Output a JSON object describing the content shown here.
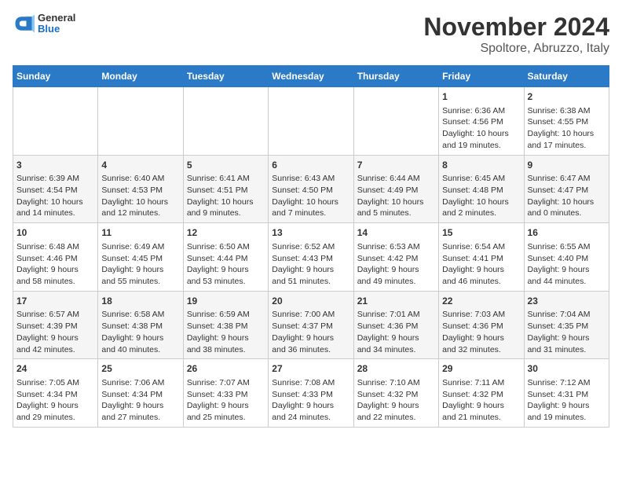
{
  "logo": {
    "general": "General",
    "blue": "Blue"
  },
  "header": {
    "title": "November 2024",
    "subtitle": "Spoltore, Abruzzo, Italy"
  },
  "weekdays": [
    "Sunday",
    "Monday",
    "Tuesday",
    "Wednesday",
    "Thursday",
    "Friday",
    "Saturday"
  ],
  "weeks": [
    [
      {
        "day": "",
        "info": ""
      },
      {
        "day": "",
        "info": ""
      },
      {
        "day": "",
        "info": ""
      },
      {
        "day": "",
        "info": ""
      },
      {
        "day": "",
        "info": ""
      },
      {
        "day": "1",
        "info": "Sunrise: 6:36 AM\nSunset: 4:56 PM\nDaylight: 10 hours\nand 19 minutes."
      },
      {
        "day": "2",
        "info": "Sunrise: 6:38 AM\nSunset: 4:55 PM\nDaylight: 10 hours\nand 17 minutes."
      }
    ],
    [
      {
        "day": "3",
        "info": "Sunrise: 6:39 AM\nSunset: 4:54 PM\nDaylight: 10 hours\nand 14 minutes."
      },
      {
        "day": "4",
        "info": "Sunrise: 6:40 AM\nSunset: 4:53 PM\nDaylight: 10 hours\nand 12 minutes."
      },
      {
        "day": "5",
        "info": "Sunrise: 6:41 AM\nSunset: 4:51 PM\nDaylight: 10 hours\nand 9 minutes."
      },
      {
        "day": "6",
        "info": "Sunrise: 6:43 AM\nSunset: 4:50 PM\nDaylight: 10 hours\nand 7 minutes."
      },
      {
        "day": "7",
        "info": "Sunrise: 6:44 AM\nSunset: 4:49 PM\nDaylight: 10 hours\nand 5 minutes."
      },
      {
        "day": "8",
        "info": "Sunrise: 6:45 AM\nSunset: 4:48 PM\nDaylight: 10 hours\nand 2 minutes."
      },
      {
        "day": "9",
        "info": "Sunrise: 6:47 AM\nSunset: 4:47 PM\nDaylight: 10 hours\nand 0 minutes."
      }
    ],
    [
      {
        "day": "10",
        "info": "Sunrise: 6:48 AM\nSunset: 4:46 PM\nDaylight: 9 hours\nand 58 minutes."
      },
      {
        "day": "11",
        "info": "Sunrise: 6:49 AM\nSunset: 4:45 PM\nDaylight: 9 hours\nand 55 minutes."
      },
      {
        "day": "12",
        "info": "Sunrise: 6:50 AM\nSunset: 4:44 PM\nDaylight: 9 hours\nand 53 minutes."
      },
      {
        "day": "13",
        "info": "Sunrise: 6:52 AM\nSunset: 4:43 PM\nDaylight: 9 hours\nand 51 minutes."
      },
      {
        "day": "14",
        "info": "Sunrise: 6:53 AM\nSunset: 4:42 PM\nDaylight: 9 hours\nand 49 minutes."
      },
      {
        "day": "15",
        "info": "Sunrise: 6:54 AM\nSunset: 4:41 PM\nDaylight: 9 hours\nand 46 minutes."
      },
      {
        "day": "16",
        "info": "Sunrise: 6:55 AM\nSunset: 4:40 PM\nDaylight: 9 hours\nand 44 minutes."
      }
    ],
    [
      {
        "day": "17",
        "info": "Sunrise: 6:57 AM\nSunset: 4:39 PM\nDaylight: 9 hours\nand 42 minutes."
      },
      {
        "day": "18",
        "info": "Sunrise: 6:58 AM\nSunset: 4:38 PM\nDaylight: 9 hours\nand 40 minutes."
      },
      {
        "day": "19",
        "info": "Sunrise: 6:59 AM\nSunset: 4:38 PM\nDaylight: 9 hours\nand 38 minutes."
      },
      {
        "day": "20",
        "info": "Sunrise: 7:00 AM\nSunset: 4:37 PM\nDaylight: 9 hours\nand 36 minutes."
      },
      {
        "day": "21",
        "info": "Sunrise: 7:01 AM\nSunset: 4:36 PM\nDaylight: 9 hours\nand 34 minutes."
      },
      {
        "day": "22",
        "info": "Sunrise: 7:03 AM\nSunset: 4:36 PM\nDaylight: 9 hours\nand 32 minutes."
      },
      {
        "day": "23",
        "info": "Sunrise: 7:04 AM\nSunset: 4:35 PM\nDaylight: 9 hours\nand 31 minutes."
      }
    ],
    [
      {
        "day": "24",
        "info": "Sunrise: 7:05 AM\nSunset: 4:34 PM\nDaylight: 9 hours\nand 29 minutes."
      },
      {
        "day": "25",
        "info": "Sunrise: 7:06 AM\nSunset: 4:34 PM\nDaylight: 9 hours\nand 27 minutes."
      },
      {
        "day": "26",
        "info": "Sunrise: 7:07 AM\nSunset: 4:33 PM\nDaylight: 9 hours\nand 25 minutes."
      },
      {
        "day": "27",
        "info": "Sunrise: 7:08 AM\nSunset: 4:33 PM\nDaylight: 9 hours\nand 24 minutes."
      },
      {
        "day": "28",
        "info": "Sunrise: 7:10 AM\nSunset: 4:32 PM\nDaylight: 9 hours\nand 22 minutes."
      },
      {
        "day": "29",
        "info": "Sunrise: 7:11 AM\nSunset: 4:32 PM\nDaylight: 9 hours\nand 21 minutes."
      },
      {
        "day": "30",
        "info": "Sunrise: 7:12 AM\nSunset: 4:31 PM\nDaylight: 9 hours\nand 19 minutes."
      }
    ]
  ]
}
